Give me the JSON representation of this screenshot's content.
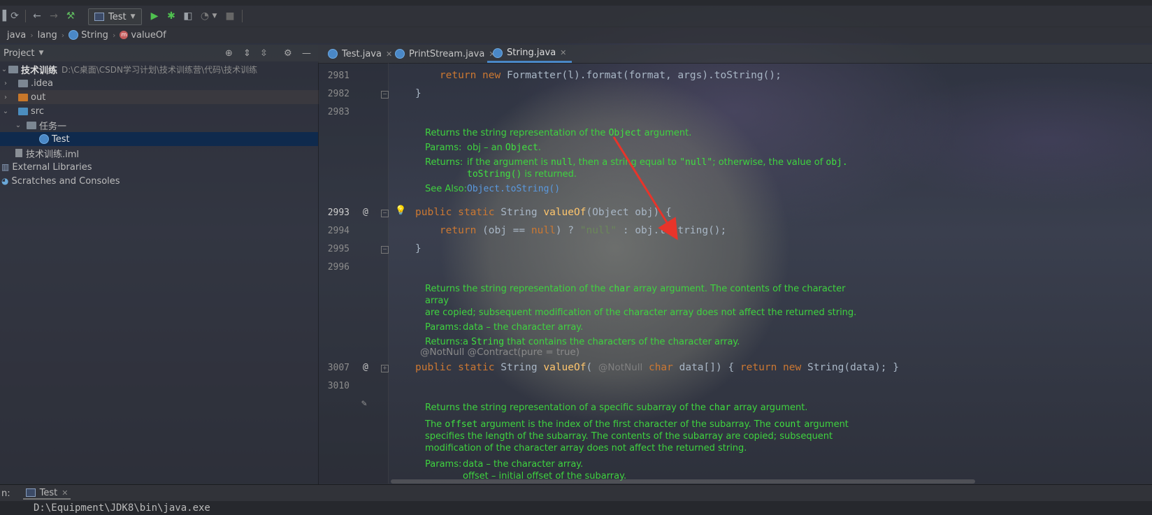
{
  "toolbar": {
    "run_config": "Test"
  },
  "breadcrumb": [
    "java",
    "lang",
    "String",
    "valueOf"
  ],
  "project": {
    "title": "Project",
    "tree": [
      {
        "label": "技术训练",
        "path": "D:\\C桌面\\CSDN学习计划\\技术训练营\\代码\\技术训练",
        "icon": "module-folder-icon",
        "expanded": true
      },
      {
        "label": ".idea",
        "icon": "folder-icon",
        "expanded": false
      },
      {
        "label": "out",
        "icon": "folder-icon",
        "expanded": false
      },
      {
        "label": "src",
        "icon": "source-folder-icon",
        "expanded": true
      },
      {
        "label": "任务一",
        "icon": "package-icon",
        "expanded": true
      },
      {
        "label": "Test",
        "icon": "class-icon",
        "selected": true
      },
      {
        "label": "技术训练.iml",
        "icon": "iml-file-icon"
      },
      {
        "label": "External Libraries",
        "icon": "libraries-icon"
      },
      {
        "label": "Scratches and Consoles",
        "icon": "scratches-icon"
      }
    ]
  },
  "editor": {
    "tabs": [
      "Test.java",
      "PrintStream.java",
      "String.java"
    ],
    "active_tab": "String.java",
    "line_numbers": [
      "2981",
      "2982",
      "2983",
      "2993",
      "2994",
      "2995",
      "2996",
      "3007",
      "3010"
    ],
    "code": {
      "line_2981": {
        "kw1": "return",
        "kw2": "new",
        "text": " Formatter(l).format(format, args).toString();"
      },
      "line_2982": "}",
      "line_2993": {
        "mods": "public static",
        "type": " String ",
        "fn": "valueOf",
        "rest": "(Object obj) {"
      },
      "line_2994": {
        "kw": "return",
        "a": " (obj == ",
        "null": "null",
        "b": ") ? ",
        "str": "\"null\"",
        "c": " : obj.toString();"
      },
      "line_2995": "}",
      "inlay_annotations": "@NotNull   @Contract(pure = true)",
      "line_3007": {
        "mods": "public static",
        "type": " String ",
        "fn": "valueOf",
        "p1": "( ",
        "ann": "@NotNull",
        "kwchar": "char",
        "p2": " data[]) { ",
        "kwret": "return",
        "kwnew": "new",
        "p3": " String(data); }"
      }
    },
    "docs": {
      "doc1": {
        "summary_pre": "Returns the string representation of the ",
        "summary_code": "Object",
        "summary_post": " argument.",
        "params_label": "Params:",
        "params": "obj – an ",
        "params_code": "Object",
        "params_post": ".",
        "returns_label": "Returns:",
        "returns_1a": "if the argument is ",
        "returns_1b": "null",
        "returns_1c": ", then a string equal to ",
        "returns_1d": "\"null\"",
        "returns_1e": "; otherwise, the value of ",
        "returns_1f": "obj.",
        "returns_2": "toString()",
        "returns_2b": " is returned.",
        "see_label": "See Also:",
        "see_link": "Object.toString()"
      },
      "doc2": {
        "line1_pre": "Returns the string representation of the ",
        "line1_code": "char",
        "line1_post": " array argument. The contents of the character array",
        "line2": "are copied; subsequent modification of the character array does not affect the returned string.",
        "params_label": "Params:",
        "params": "data – the character array.",
        "returns_label": "Returns:",
        "returns_pre": "a ",
        "returns_code": "String",
        "returns_post": " that contains the characters of the character array."
      },
      "doc3": {
        "line1_pre": "Returns the string representation of a specific subarray of the ",
        "line1_code": "char",
        "line1_post": " array argument.",
        "p2_a": "The ",
        "p2_code1": "offset",
        "p2_b": " argument is the index of the first character of the subarray. The ",
        "p2_code2": "count",
        "p2_c": " argument",
        "p2_line2": "specifies the length of the subarray. The contents of the subarray are copied; subsequent",
        "p2_line3": "modification of the character array does not affect the returned string.",
        "params_label": "Params:",
        "params1": "data – the character array.",
        "params2": "offset – initial offset of the subarray."
      }
    },
    "gutter_marks": {
      "at": "@"
    }
  },
  "bottom": {
    "prefix": "n:",
    "run_tab": "Test",
    "console_text": "D:\\Equipment\\JDK8\\bin\\java.exe"
  },
  "colors": {
    "keyword": "#cc7832",
    "function": "#ffc66d",
    "string": "#6a8759",
    "doc_text": "#3fd33f",
    "doc_link": "#5a9ae0",
    "selection": "#0d294e",
    "arrow": "#e8342a"
  }
}
